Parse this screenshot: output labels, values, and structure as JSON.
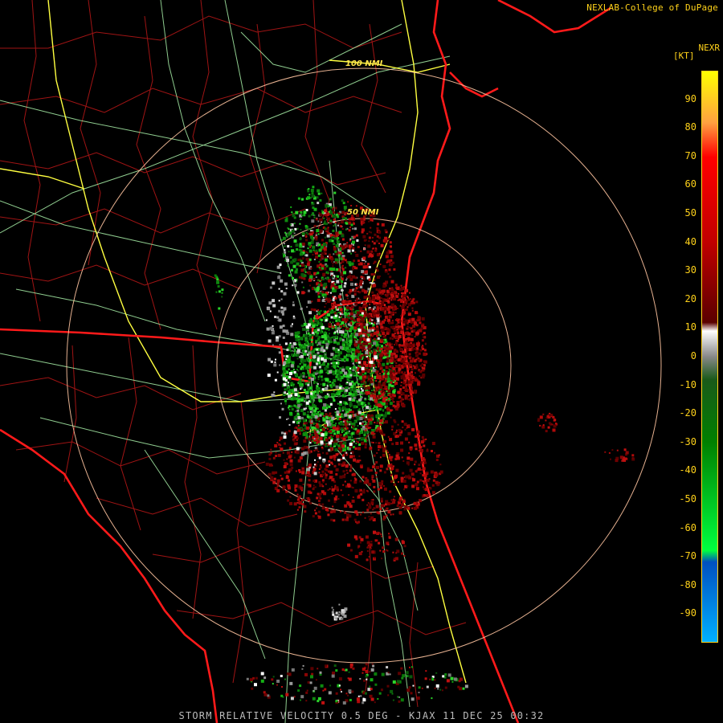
{
  "credit": "NEXLAB-College of DuPage",
  "product": "NEXR",
  "unit": "[KT]",
  "ring_labels": [
    "100 NMI",
    "50 NMI"
  ],
  "footer": "STORM RELATIVE VELOCITY 0.5 DEG - KJAX 11 DEC 25 00:32",
  "legend": {
    "ticks": [
      "90",
      "80",
      "70",
      "60",
      "50",
      "40",
      "30",
      "20",
      "10",
      "0",
      "-10",
      "-20",
      "-30",
      "-40",
      "-50",
      "-60",
      "-70",
      "-80",
      "-90"
    ],
    "min": -100,
    "max": 100,
    "stops": [
      {
        "v": 100,
        "color": "#ffff00"
      },
      {
        "v": 82,
        "color": "#ffa040"
      },
      {
        "v": 70,
        "color": "#ff0000"
      },
      {
        "v": 40,
        "color": "#c00000"
      },
      {
        "v": 12,
        "color": "#5a0000"
      },
      {
        "v": 9,
        "color": "#ffffff"
      },
      {
        "v": 0,
        "color": "#888888"
      },
      {
        "v": -8,
        "color": "#1a5a1a"
      },
      {
        "v": -30,
        "color": "#008000"
      },
      {
        "v": -68,
        "color": "#00ff40"
      },
      {
        "v": -72,
        "color": "#0050c0"
      },
      {
        "v": -100,
        "color": "#00b0ff"
      }
    ]
  },
  "colors": {
    "state_line": "#ff1a1a",
    "county_line": "#a01414",
    "road": "#a8f0a8",
    "interstate": "#ffff40",
    "range_ring": "#ffc4a0",
    "text": "#ffd21a"
  }
}
